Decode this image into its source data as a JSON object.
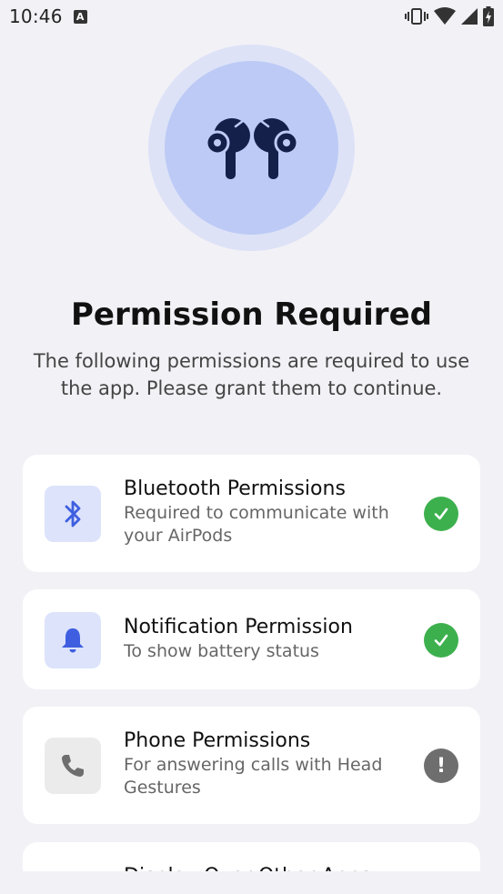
{
  "status_bar": {
    "time": "10:46",
    "notification_icon": "A"
  },
  "hero": {
    "icon": "airpods-icon"
  },
  "title": "Permission Required",
  "subtitle": "The following permissions are required to use the app. Please grant them to continue.",
  "permissions": [
    {
      "title": "Bluetooth Permissions",
      "description": "Required to communicate with your AirPods",
      "icon": "bluetooth-icon",
      "status": "granted"
    },
    {
      "title": "Notification Permission",
      "description": "To show battery status",
      "icon": "bell-icon",
      "status": "granted"
    },
    {
      "title": "Phone Permissions",
      "description": "For answering calls with Head Gestures",
      "icon": "phone-icon",
      "status": "not granted"
    },
    {
      "title": "Display Over Other Apps",
      "description": "",
      "icon": "",
      "status": ""
    }
  ],
  "colors": {
    "background": "#F2F1F6",
    "accent": "#3F5FE0",
    "granted": "#3DB04E",
    "pending": "#6E6E6E"
  }
}
